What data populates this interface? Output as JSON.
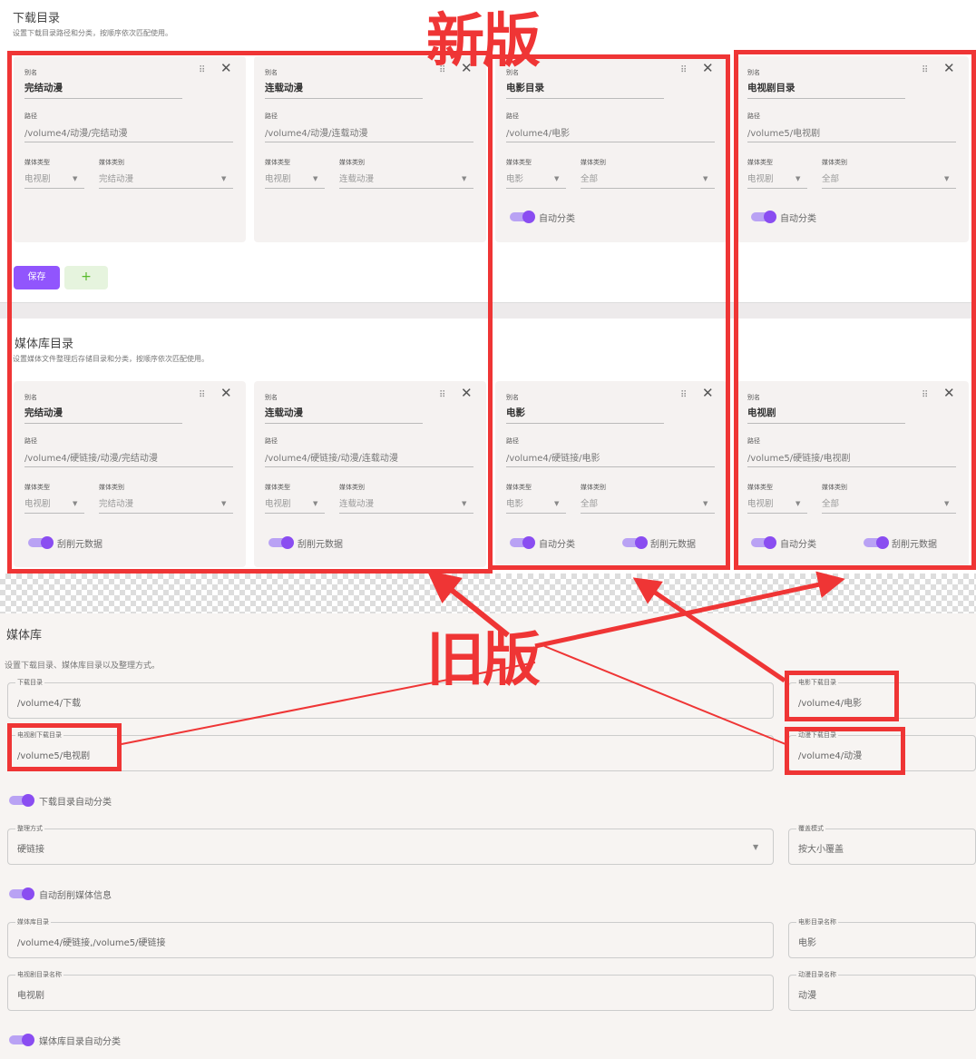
{
  "download": {
    "title": "下载目录",
    "subtitle": "设置下载目录路径和分类，按顺序依次匹配使用。"
  },
  "library": {
    "title": "媒体库目录",
    "subtitle": "设置媒体文件整理后存储目录和分类，按顺序依次匹配使用。"
  },
  "labels": {
    "alias": "别名",
    "path": "路径",
    "media_type": "媒体类型",
    "media_category": "媒体类别",
    "auto_classify": "自动分类",
    "scrape": "刮削元数据"
  },
  "icons": {
    "drag": "drag-icon",
    "close": "close-icon",
    "caret": "caret-down-icon"
  },
  "download_cards": [
    {
      "alias": "完结动漫",
      "path": "/volume4/动漫/完结动漫",
      "type": "电视剧",
      "category": "完结动漫"
    },
    {
      "alias": "连载动漫",
      "path": "/volume4/动漫/连载动漫",
      "type": "电视剧",
      "category": "连载动漫"
    },
    {
      "alias": "电影目录",
      "path": "/volume4/电影",
      "type": "电影",
      "category": "全部"
    },
    {
      "alias": "电视剧目录",
      "path": "/volume5/电视剧",
      "type": "电视剧",
      "category": "全部"
    }
  ],
  "buttons": {
    "save": "保存",
    "add": "+"
  },
  "library_cards": [
    {
      "alias": "完结动漫",
      "path": "/volume4/硬链接/动漫/完结动漫",
      "type": "电视剧",
      "category": "完结动漫"
    },
    {
      "alias": "连载动漫",
      "path": "/volume4/硬链接/动漫/连载动漫",
      "type": "电视剧",
      "category": "连载动漫"
    },
    {
      "alias": "电影",
      "path": "/volume4/硬链接/电影",
      "type": "电影",
      "category": "全部"
    },
    {
      "alias": "电视剧",
      "path": "/volume5/硬链接/电视剧",
      "type": "电视剧",
      "category": "全部"
    }
  ],
  "annotations": {
    "new": "新版",
    "old": "旧版"
  },
  "old": {
    "title": "媒体库",
    "subtitle": "设置下载目录、媒体库目录以及整理方式。",
    "download_dir": {
      "label": "下载目录",
      "value": "/volume4/下载"
    },
    "movie_download_dir": {
      "label": "电影下载目录",
      "value": "/volume4/电影"
    },
    "tv_download_dir": {
      "label": "电视剧下载目录",
      "value": "/volume5/电视剧"
    },
    "anime_download_dir": {
      "label": "动漫下载目录",
      "value": "/volume4/动漫"
    },
    "download_auto_classify": "下载目录自动分类",
    "transfer_mode": {
      "label": "整理方式",
      "value": "硬链接"
    },
    "overwrite_mode": {
      "label": "覆盖模式",
      "value": "按大小覆盖"
    },
    "auto_scrape": "自动刮削媒体信息",
    "library_dir": {
      "label": "媒体库目录",
      "value": "/volume4/硬链接,/volume5/硬链接"
    },
    "movie_dir_name": {
      "label": "电影目录名称",
      "value": "电影"
    },
    "tv_dir_name": {
      "label": "电视剧目录名称",
      "value": "电视剧"
    },
    "anime_dir_name": {
      "label": "动漫目录名称",
      "value": "动漫"
    },
    "library_auto_classify": "媒体库目录自动分类"
  }
}
